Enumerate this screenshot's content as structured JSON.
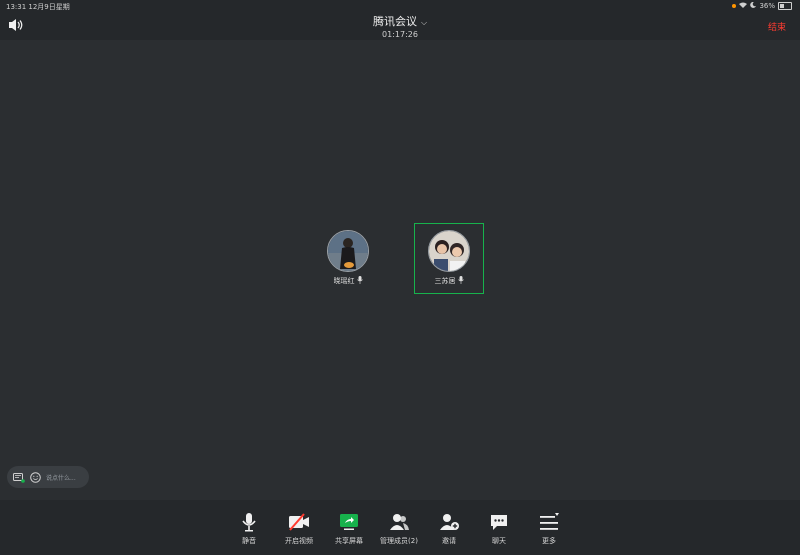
{
  "status_bar": {
    "time_date": "13:31  12月9日星期",
    "battery": "36%"
  },
  "header": {
    "title": "腾讯会议",
    "timer": "01:17:26",
    "end_label": "结束"
  },
  "participants": [
    {
      "name": "晓瑶红"
    },
    {
      "name": "三苏居"
    }
  ],
  "chat": {
    "placeholder": "说点什么..."
  },
  "toolbar": {
    "mute": "静音",
    "video": "开启视频",
    "share": "共享屏幕",
    "members": "管理成员(2)",
    "invite": "邀请",
    "chat": "聊天",
    "more": "更多"
  },
  "colors": {
    "accent_green": "#17b24c",
    "end_red": "#ff3b30",
    "status_orange": "#ff9500"
  }
}
